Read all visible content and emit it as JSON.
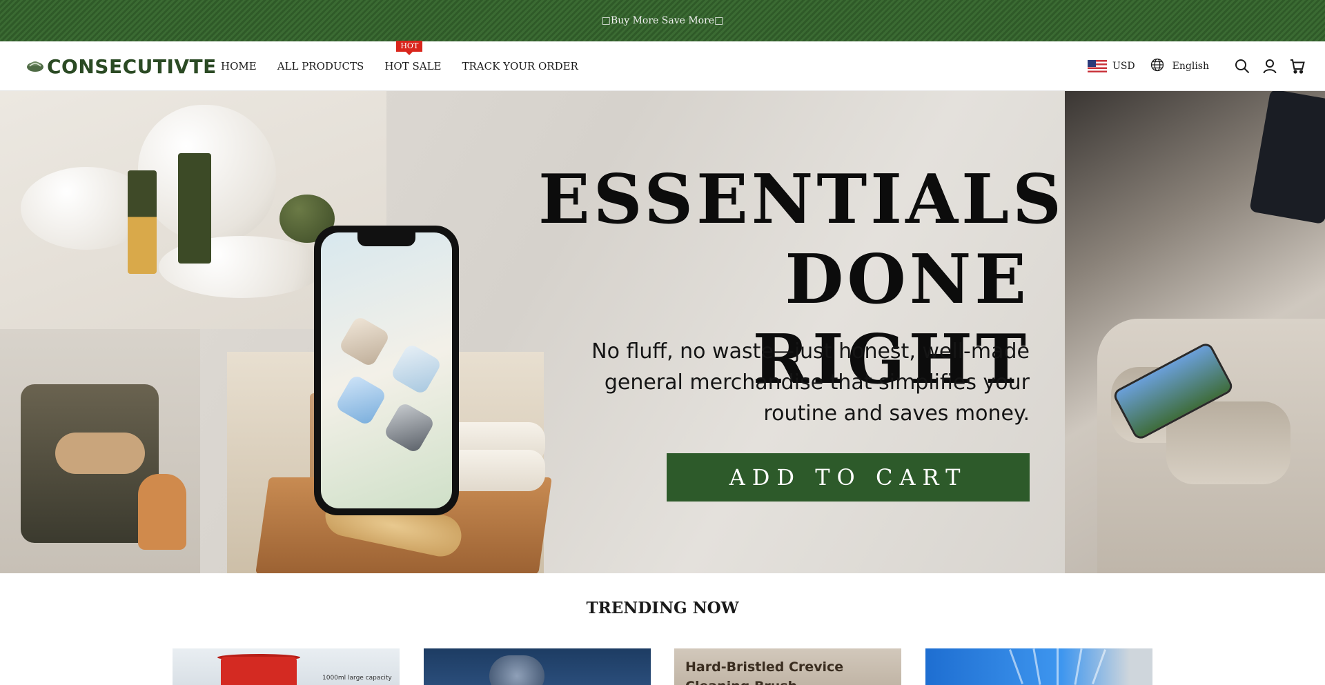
{
  "announcement": {
    "text": "□Buy More Save More□"
  },
  "header": {
    "logo_text": "CONSECUTIVTE",
    "nav": [
      {
        "label": "HOME"
      },
      {
        "label": "ALL PRODUCTS"
      },
      {
        "label": "HOT SALE",
        "badge": "HOT"
      },
      {
        "label": "TRACK YOUR ORDER"
      }
    ],
    "currency": "USD",
    "language": "English",
    "icons": [
      "flag-us-icon",
      "globe-icon",
      "search-icon",
      "account-icon",
      "cart-icon"
    ]
  },
  "hero": {
    "title_line1": "ESSENTIALS",
    "title_line2": "DONE RIGHT",
    "subtitle_line1": "No fluff, no waste—just honest, well-made",
    "subtitle_line2": "general merchandise that simplifies your",
    "subtitle_line3": "routine and saves money.",
    "cta_label": "ADD TO CART"
  },
  "trending": {
    "title": "TRENDING NOW",
    "cards": [
      {
        "image_text": "1000ml large capacity"
      },
      {
        "image_text": ""
      },
      {
        "image_text_line1": "Hard-Bristled Crevice",
        "image_text_line2": "Cleaning Brush"
      },
      {
        "image_text": ""
      }
    ]
  },
  "colors": {
    "brand_green": "#2d5a2a",
    "announcement_green": "#355f2e",
    "hot_badge_red": "#d9261c"
  }
}
